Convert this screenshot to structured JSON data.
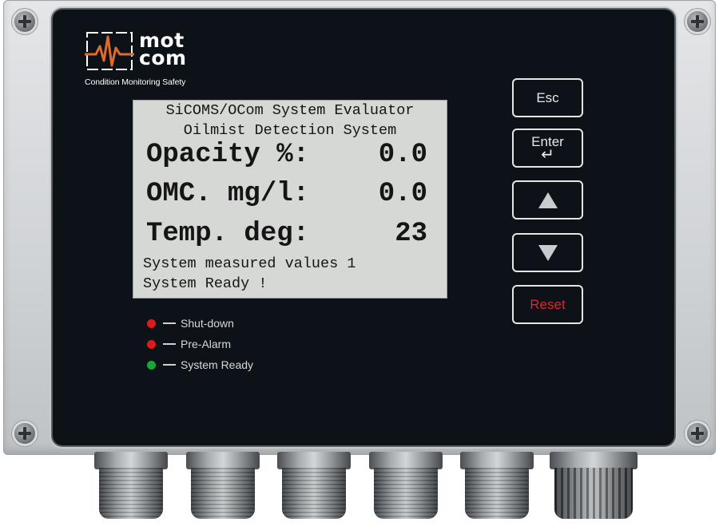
{
  "logo": {
    "brand_line1": "mot",
    "brand_line2": "com",
    "tagline": "Condition Monitoring Safety",
    "accent_color": "#e06a2a"
  },
  "display": {
    "line1": "SiCOMS/OCom System Evaluator",
    "line2": "Oilmist Detection System",
    "opacity_label": "Opacity %:",
    "opacity_value": "0.0",
    "omc_label": "OMC. mg/l:",
    "omc_value": "0.0",
    "temp_label": "Temp. deg:",
    "temp_value": "23",
    "status1": "System measured values 1",
    "status2": "System Ready !"
  },
  "indicators": [
    {
      "label": "Shut-down",
      "color": "#e01a1a"
    },
    {
      "label": "Pre-Alarm",
      "color": "#e01a1a"
    },
    {
      "label": "System Ready",
      "color": "#18a83a"
    }
  ],
  "buttons": {
    "esc": "Esc",
    "enter": "Enter",
    "enter_symbol": "↵",
    "up_icon": "triangle-up",
    "down_icon": "triangle-down",
    "reset": "Reset"
  }
}
